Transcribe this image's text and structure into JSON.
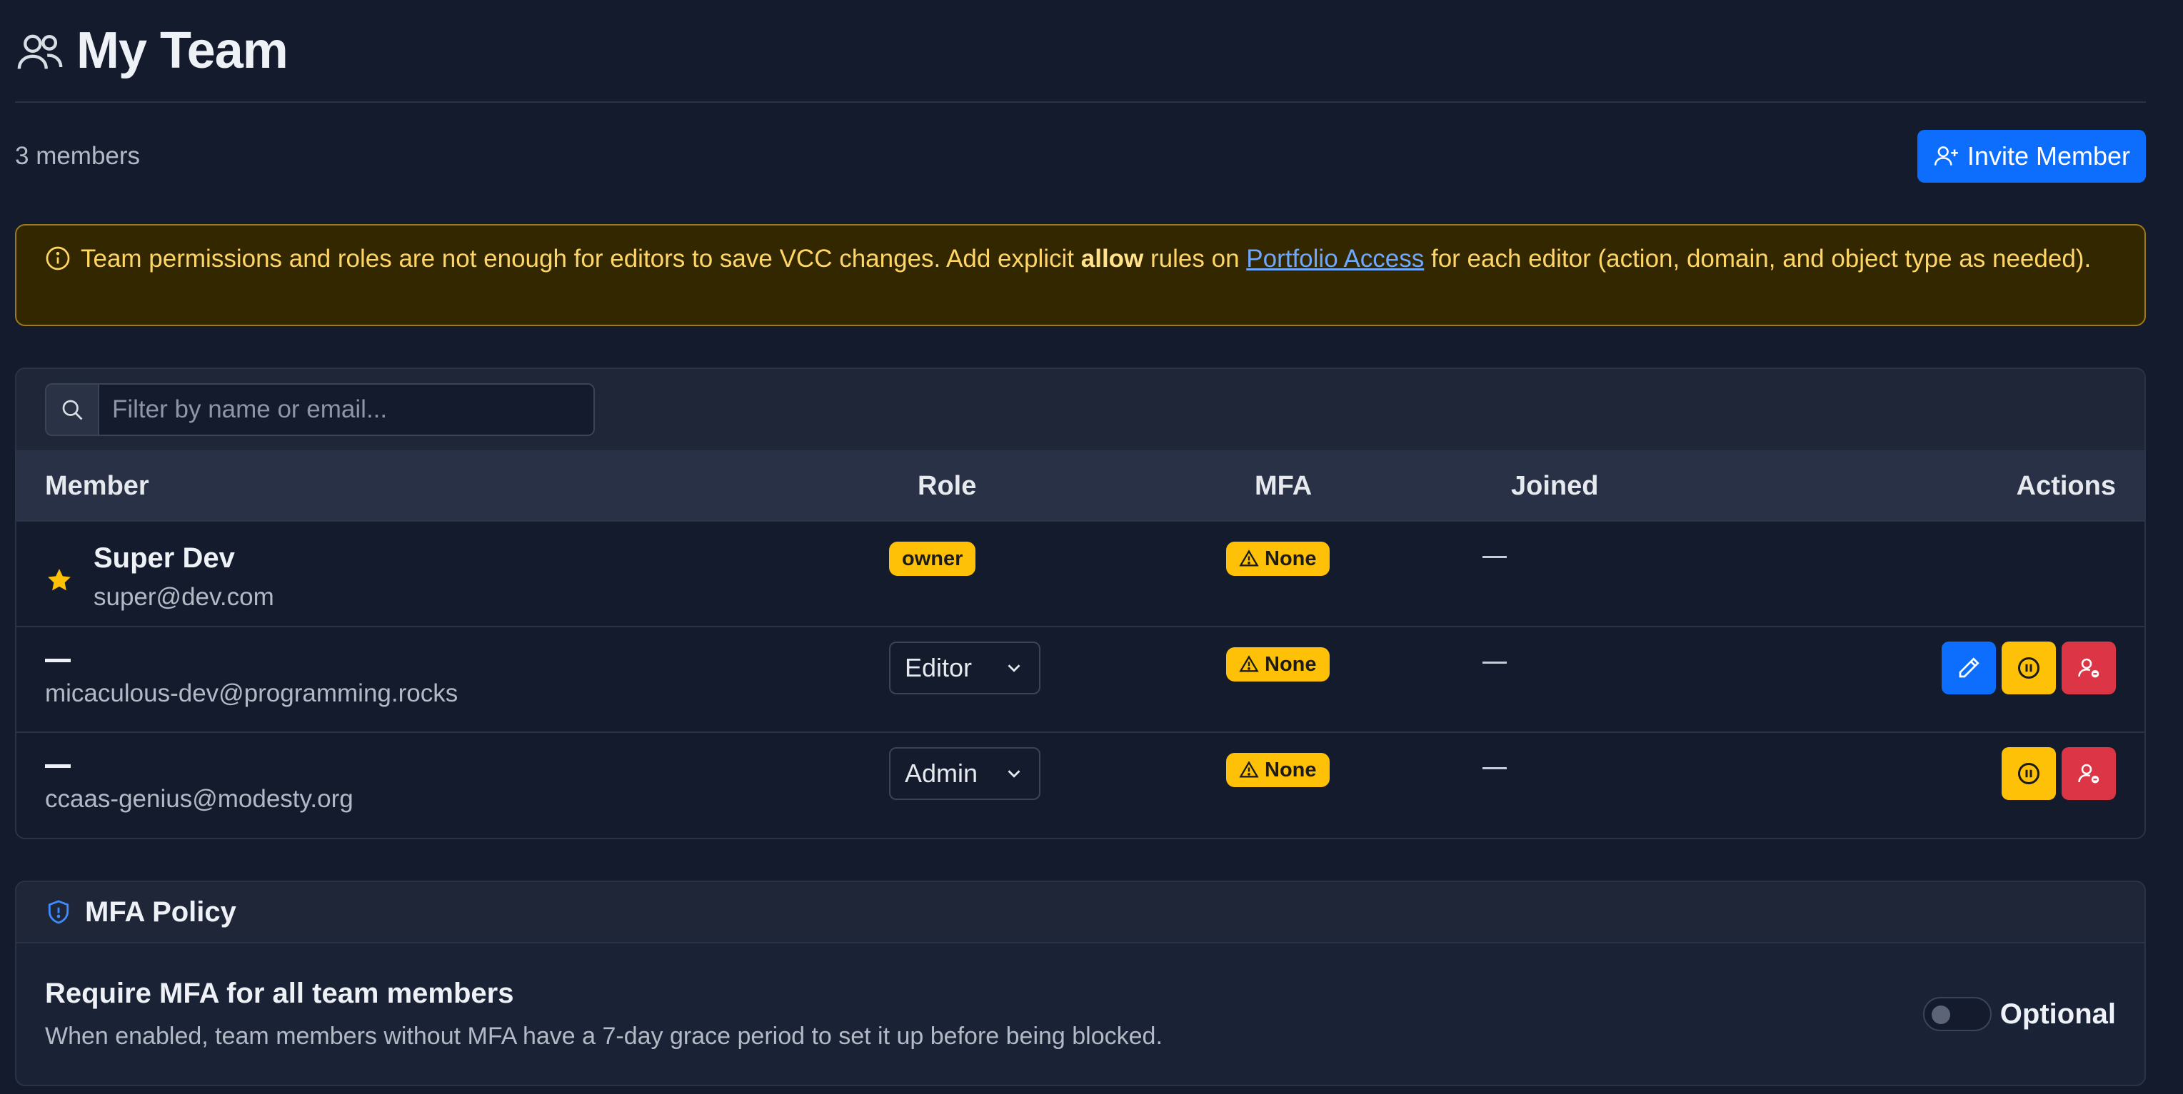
{
  "header": {
    "title": "My Team",
    "icon": "team-icon"
  },
  "subbar": {
    "member_count": "3 members",
    "invite_label": "Invite Member"
  },
  "alert": {
    "text_before": "Team permissions and roles are not enough for editors to save VCC changes. Add explicit ",
    "bold": "allow",
    "text_middle": " rules on ",
    "link": "Portfolio Access",
    "text_after": " for each editor (action, domain, and object type as needed)."
  },
  "filter": {
    "placeholder": "Filter by name or email..."
  },
  "table": {
    "headers": {
      "member": "Member",
      "role": "Role",
      "mfa": "MFA",
      "joined": "Joined",
      "actions": "Actions"
    },
    "rows": [
      {
        "name": "Super Dev",
        "email": "super@dev.com",
        "role": "owner",
        "mfa": "None",
        "joined": "—"
      },
      {
        "name": "—",
        "email": "micaculous-dev@programming.rocks",
        "role": "Editor",
        "mfa": "None",
        "joined": "—"
      },
      {
        "name": "—",
        "email": "ccaas-genius@modesty.org",
        "role": "Admin",
        "mfa": "None",
        "joined": "—"
      }
    ]
  },
  "mfa_policy": {
    "title": "MFA Policy",
    "setting_title": "Require MFA for all team members",
    "setting_desc": "When enabled, team members without MFA have a 7-day grace period to set it up before being blocked.",
    "toggle_label": "Optional",
    "enabled": false
  },
  "colors": {
    "background": "#141b2d",
    "primary": "#0d6efd",
    "warning": "#ffc107",
    "danger": "#dc3545",
    "alert_bg": "#332700",
    "alert_text": "#ffd666"
  }
}
